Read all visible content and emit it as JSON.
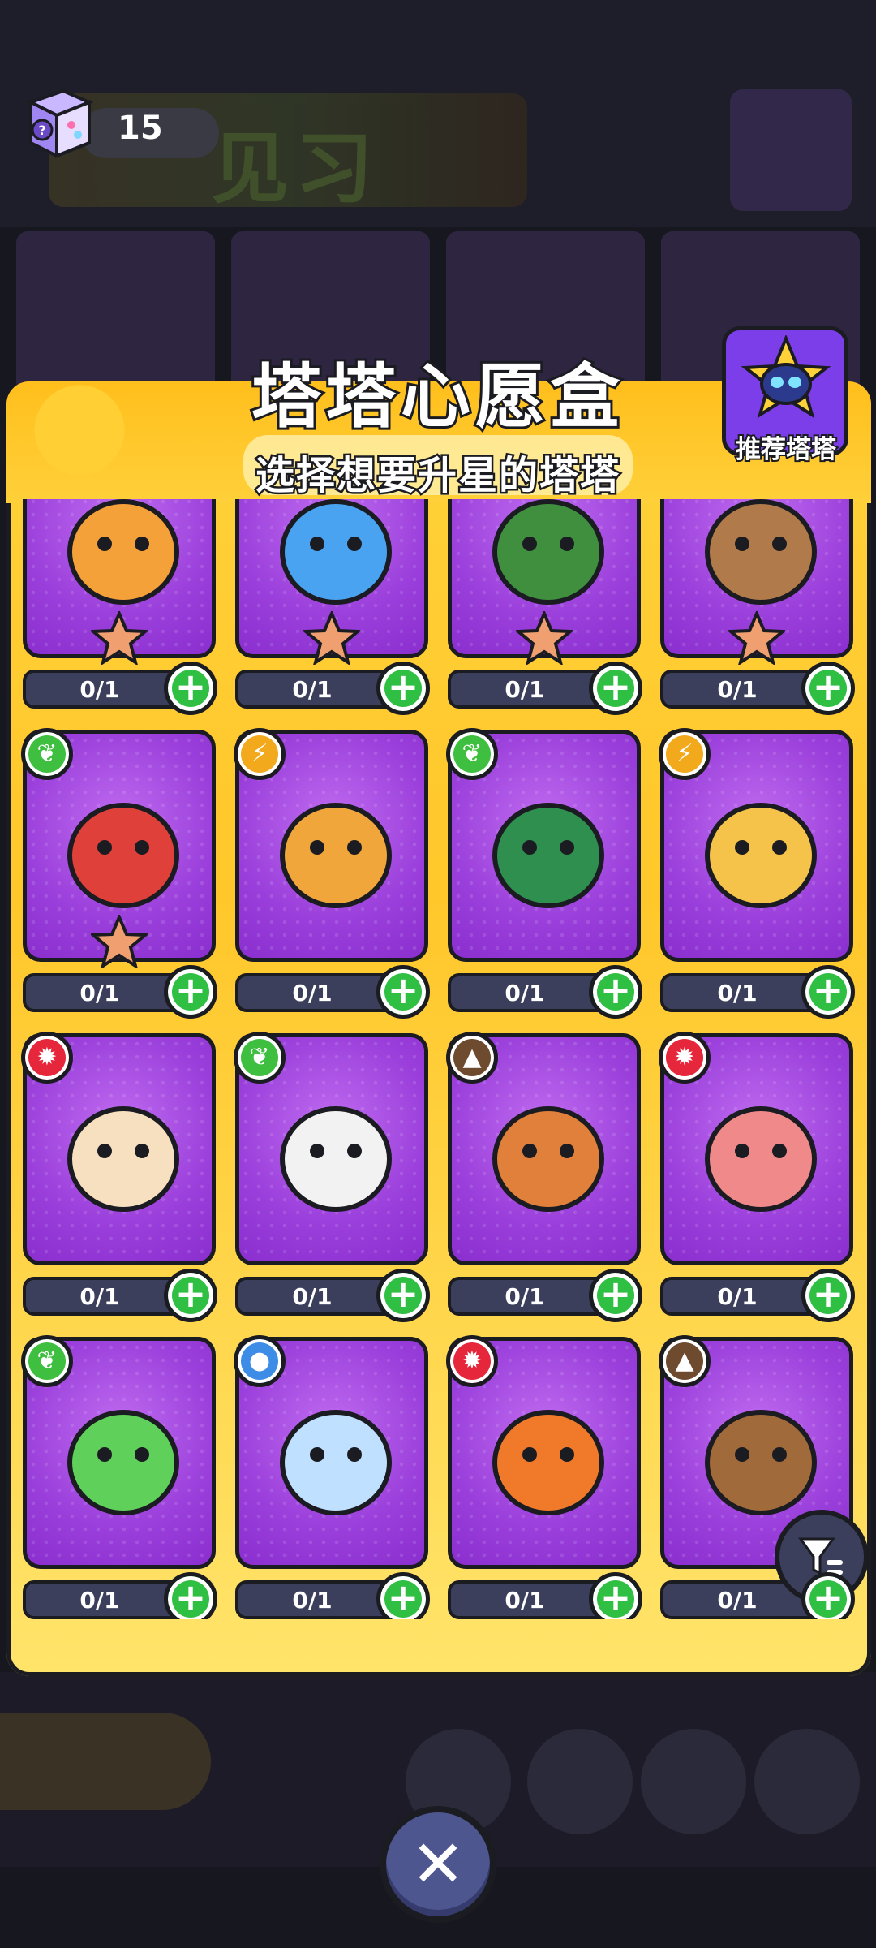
{
  "currency": {
    "count": "15",
    "icon": "mystery-box-icon"
  },
  "background": {
    "banner_text": "见习"
  },
  "dialog": {
    "title": "塔塔心愿盒",
    "subtitle": "选择想要升星的塔塔",
    "recommend_label": "推荐塔塔"
  },
  "colors": {
    "green": "#3fbf3f",
    "yellow": "#f2a91c",
    "red": "#e6263a",
    "brown": "#6e4a2e",
    "blue": "#3d8de6",
    "card": "#9a3fdb",
    "plus": "#2fbf43"
  },
  "cards": [
    {
      "progress": "0/1",
      "element": "none",
      "star": true,
      "creature": "cat-fortune-icon",
      "hue": "#f5a13a"
    },
    {
      "progress": "0/1",
      "element": "none",
      "star": true,
      "creature": "octopus-icon",
      "hue": "#4aa3f0"
    },
    {
      "progress": "0/1",
      "element": "none",
      "star": true,
      "creature": "bird-icon",
      "hue": "#3f8f3f"
    },
    {
      "progress": "0/1",
      "element": "none",
      "star": true,
      "creature": "bear-flower-icon",
      "hue": "#b07a4a"
    },
    {
      "progress": "0/1",
      "element": "leaf",
      "star": true,
      "creature": "tulip-icon",
      "hue": "#e0403a"
    },
    {
      "progress": "0/1",
      "element": "bolt",
      "star": false,
      "creature": "dog-icon",
      "hue": "#f0a63a"
    },
    {
      "progress": "0/1",
      "element": "leaf",
      "star": false,
      "creature": "turtle-leaf-icon",
      "hue": "#2f8f4f"
    },
    {
      "progress": "0/1",
      "element": "bolt",
      "star": false,
      "creature": "fox-dog-icon",
      "hue": "#f5c24a"
    },
    {
      "progress": "0/1",
      "element": "fire",
      "star": false,
      "creature": "chick-icon",
      "hue": "#f7e0c0"
    },
    {
      "progress": "0/1",
      "element": "leaf",
      "star": false,
      "creature": "panda-icon",
      "hue": "#f2f2f2"
    },
    {
      "progress": "0/1",
      "element": "earth",
      "star": false,
      "creature": "kangaroo-icon",
      "hue": "#e0803a"
    },
    {
      "progress": "0/1",
      "element": "fire",
      "star": false,
      "creature": "pig-bowl-icon",
      "hue": "#f08a8a"
    },
    {
      "progress": "0/1",
      "element": "leaf",
      "star": false,
      "creature": "frog-icon",
      "hue": "#5fd05a"
    },
    {
      "progress": "0/1",
      "element": "water",
      "star": false,
      "creature": "jellyfish-icon",
      "hue": "#bfe0ff"
    },
    {
      "progress": "0/1",
      "element": "fire",
      "star": false,
      "creature": "tiger-icon",
      "hue": "#f07a2a"
    },
    {
      "progress": "0/1",
      "element": "earth",
      "star": false,
      "creature": "snail-icon",
      "hue": "#a06a3a"
    }
  ],
  "filter": {
    "icon": "filter-icon"
  },
  "close": {
    "icon": "close-icon"
  }
}
